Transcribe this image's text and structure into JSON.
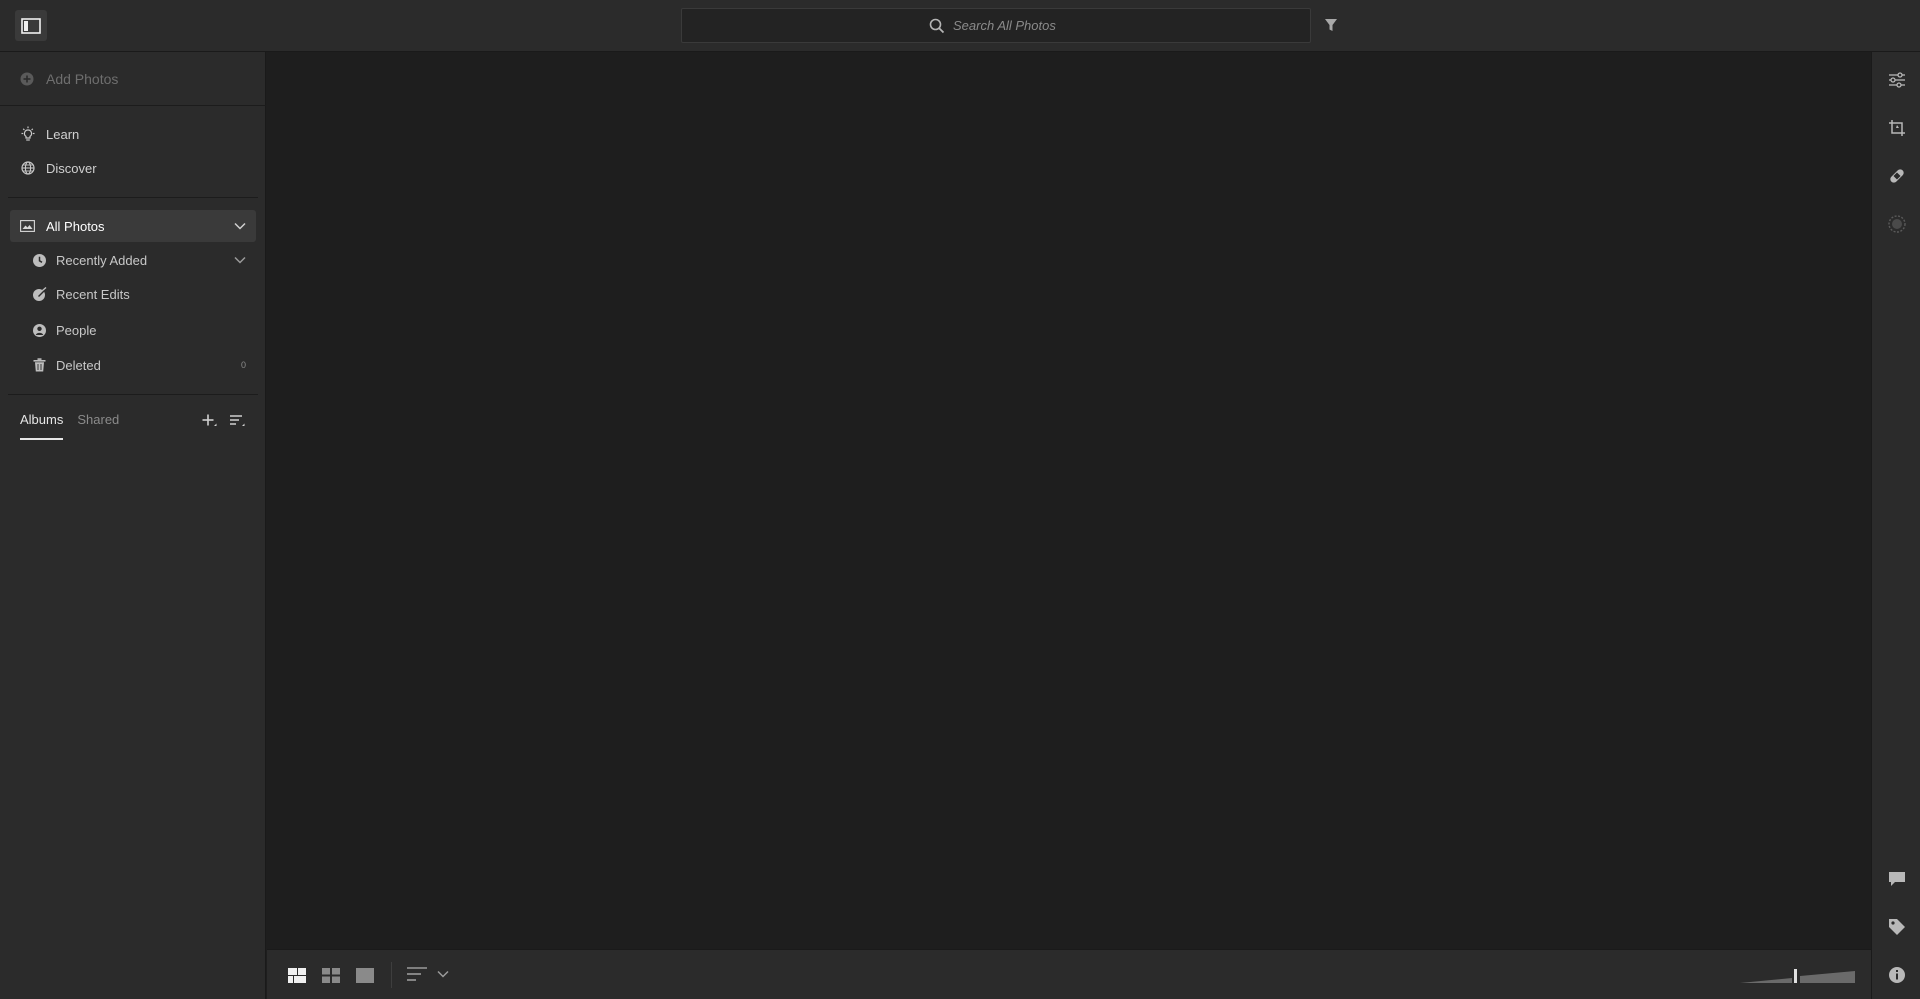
{
  "search": {
    "placeholder": "Search All Photos"
  },
  "sidebar": {
    "add_photos": "Add Photos",
    "nav": [
      {
        "label": "Learn",
        "icon": "lightbulb-icon"
      },
      {
        "label": "Discover",
        "icon": "globe-icon"
      }
    ],
    "library": {
      "label": "All Photos",
      "items": [
        {
          "label": "Recently Added",
          "icon": "clock-icon"
        },
        {
          "label": "Recent Edits",
          "icon": "edit-brush-icon"
        },
        {
          "label": "People",
          "icon": "person-icon"
        },
        {
          "label": "Deleted",
          "icon": "trash-icon",
          "count": "0"
        }
      ]
    },
    "album_tabs": [
      {
        "label": "Albums",
        "active": true
      },
      {
        "label": "Shared",
        "active": false
      }
    ]
  },
  "bottom_toolbar": {
    "view_modes": [
      "square-grid-view",
      "photo-grid-view",
      "detail-view"
    ],
    "sort_icon": "sort-lines-icon"
  },
  "right_rail": {
    "top_tools": [
      "edit-sliders-icon",
      "crop-icon",
      "healing-bandage-icon",
      "masking-icon"
    ],
    "bottom_tools": [
      "comment-icon",
      "tag-icon",
      "info-icon"
    ]
  },
  "colors": {
    "panel": "#2b2b2b",
    "canvas": "#1e1e1e",
    "selected": "#3a3a3a",
    "text": "#d0d0d0"
  }
}
